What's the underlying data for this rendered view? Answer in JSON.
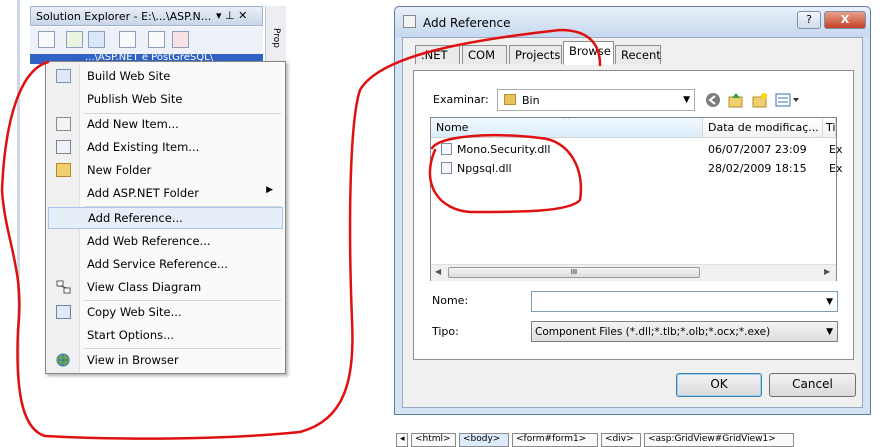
{
  "solution_explorer": {
    "title": "Solution Explorer - E:\\...\\ASP.N...",
    "pin": "▾ ⊥ ✕",
    "tree_selected": "...\\ASP.NET e PostGreSQL\\",
    "side_strip_label": "Prop"
  },
  "context_menu": {
    "items": [
      {
        "label": "Build Web Site",
        "icon": "build-icon"
      },
      {
        "label": "Publish Web Site",
        "icon": ""
      },
      {
        "label": "Add New Item...",
        "icon": "new-item-icon"
      },
      {
        "label": "Add Existing Item...",
        "icon": "existing-item-icon"
      },
      {
        "label": "New Folder",
        "icon": "folder-icon"
      },
      {
        "label": "Add ASP.NET Folder",
        "icon": "",
        "submenu": true
      },
      {
        "label": "Add Reference...",
        "icon": "",
        "highlighted": true
      },
      {
        "label": "Add Web Reference...",
        "icon": ""
      },
      {
        "label": "Add Service Reference...",
        "icon": ""
      },
      {
        "label": "View Class Diagram",
        "icon": "class-diagram-icon"
      },
      {
        "label": "Copy Web Site...",
        "icon": "copy-web-icon"
      },
      {
        "label": "Start Options...",
        "icon": ""
      },
      {
        "label": "View in Browser",
        "icon": "browser-icon"
      }
    ]
  },
  "dialog": {
    "title": "Add Reference",
    "help_button": "?",
    "close_button": "X",
    "tabs": [
      ".NET",
      "COM",
      "Projects",
      "Browse",
      "Recent"
    ],
    "active_tab": "Browse",
    "look_in_label": "Examinar:",
    "look_in_value": "Bin",
    "columns": [
      "Nome",
      "Data de modificaç...",
      "Ti"
    ],
    "files": [
      {
        "name": "Mono.Security.dll",
        "date": "06/07/2007 23:09",
        "type": "Ex"
      },
      {
        "name": "Npgsql.dll",
        "date": "28/02/2009 18:15",
        "type": "Ex"
      }
    ],
    "scroll_thumb": "III",
    "name_label": "Nome:",
    "name_value": "",
    "type_label": "Tipo:",
    "type_value": "Component Files (*.dll;*.tlb;*.olb;*.ocx;*.exe)",
    "ok": "OK",
    "cancel": "Cancel"
  },
  "breadcrumb": [
    "<html>",
    "<body>",
    "<form#form1>",
    "<div>",
    "<asp:GridView#GridView1>"
  ],
  "colors": {
    "annotation": "#e01010",
    "selection": "#3163c5",
    "highlight": "#e6eef8"
  }
}
